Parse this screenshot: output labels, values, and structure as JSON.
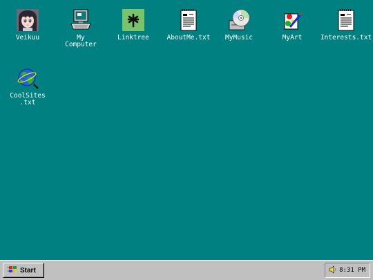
{
  "desktop": {
    "icons": [
      {
        "label": "Veikuu",
        "icon": "anime-avatar-icon"
      },
      {
        "label": "My\nComputer",
        "icon": "computer-icon"
      },
      {
        "label": "Linktree",
        "icon": "linktree-icon"
      },
      {
        "label": "AboutMe.txt",
        "icon": "text-file-icon"
      },
      {
        "label": "MyMusic",
        "icon": "cd-music-icon"
      },
      {
        "label": "MyArt",
        "icon": "paint-icon"
      },
      {
        "label": "Interests.txt",
        "icon": "text-file-icon"
      },
      {
        "label": "CoolSites\n.txt",
        "icon": "globe-icon"
      }
    ]
  },
  "taskbar": {
    "start_label": "Start",
    "clock": "8:31 PM"
  },
  "colors": {
    "desktop_bg": "#008080",
    "taskbar_bg": "#c0c0c0",
    "linktree_green": "#79c36a"
  }
}
